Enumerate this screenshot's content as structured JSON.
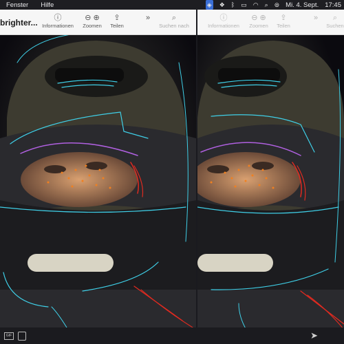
{
  "menubar": {
    "items": [
      "Fenster",
      "Hilfe"
    ],
    "datetime": "Mi. 4. Sept.",
    "time": "17:45",
    "icons": [
      "location-icon",
      "dropbox-icon",
      "bluetooth-icon",
      "battery-icon",
      "wifi-icon",
      "search-icon",
      "control-center-icon"
    ]
  },
  "window1": {
    "title": "brighter...",
    "toolbar": [
      {
        "label": "Informationen",
        "icon": "info-icon"
      },
      {
        "label": "Zoomen",
        "icon": "zoom-icon"
      },
      {
        "label": "Teilen",
        "icon": "share-icon"
      },
      {
        "label": "Suchen nach",
        "icon": "search-icon"
      }
    ]
  },
  "window2": {
    "toolbar": [
      {
        "label": "Informationen",
        "icon": "info-icon"
      },
      {
        "label": "Zoomen",
        "icon": "zoom-icon"
      },
      {
        "label": "Teilen",
        "icon": "share-icon"
      },
      {
        "label": "Suchen",
        "icon": "search-icon"
      }
    ]
  },
  "bottombar": {
    "gif_label": "GIF",
    "icons": [
      "gif-icon",
      "sticker-icon",
      "send-icon"
    ]
  }
}
